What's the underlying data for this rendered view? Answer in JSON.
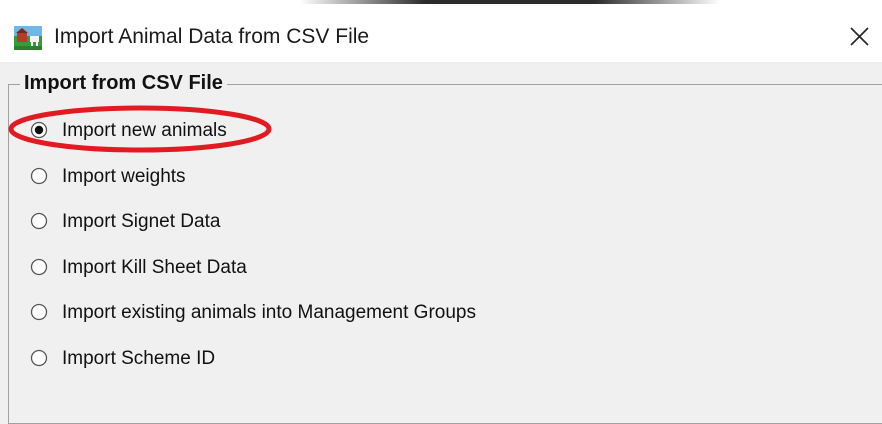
{
  "window": {
    "title": "Import Animal Data from CSV File",
    "close_icon": "close-icon",
    "app_icon": "farm-app-icon"
  },
  "group": {
    "legend": "Import from CSV File",
    "options": [
      {
        "label": "Import new animals",
        "selected": true
      },
      {
        "label": "Import weights",
        "selected": false
      },
      {
        "label": "Import Signet Data",
        "selected": false
      },
      {
        "label": "Import Kill Sheet Data",
        "selected": false
      },
      {
        "label": "Import existing animals into Management Groups",
        "selected": false
      },
      {
        "label": "Import Scheme ID",
        "selected": false
      }
    ]
  },
  "colors": {
    "highlight": "#e21b23",
    "window_bg": "#f0f0f0",
    "titlebar_bg": "#ffffff"
  }
}
